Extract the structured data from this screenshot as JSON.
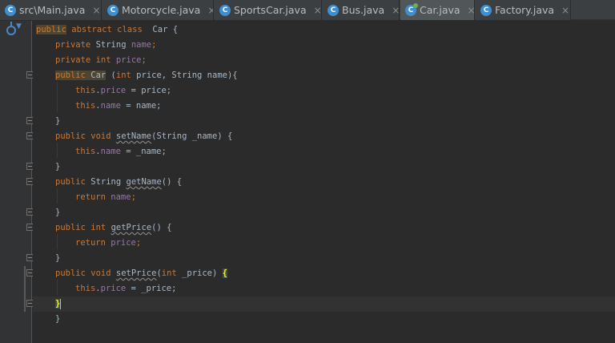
{
  "tabs": [
    {
      "label": "src\\Main.java",
      "icon": "class-icon",
      "active": false
    },
    {
      "label": "Motorcycle.java",
      "icon": "class-icon",
      "active": false
    },
    {
      "label": "SportsCar.java",
      "icon": "class-icon",
      "active": false
    },
    {
      "label": "Bus.java",
      "icon": "class-icon",
      "active": false
    },
    {
      "label": "Car.java",
      "icon": "abstract-class-icon",
      "active": true
    },
    {
      "label": "Factory.java",
      "icon": "class-icon",
      "active": false
    }
  ],
  "tab_icon_letter": "C",
  "tab_close_glyph": "×",
  "gutter_icon": "implemented-by-icon",
  "code": {
    "l1": {
      "t1": "public",
      "t2": " abstract",
      "t3": " class",
      "t4": "  Car {"
    },
    "l2": {
      "t1": "private",
      "t2": " String ",
      "t3": "name",
      "t4": ";"
    },
    "l3": {
      "t1": "private",
      "t2": " int ",
      "t3": "price",
      "t4": ";"
    },
    "l4": {
      "t1": "public",
      "t2": " Car",
      "t3": " (",
      "t4": "int",
      "t5": " price, String name){"
    },
    "l5": {
      "t1": "this",
      "t2": ".",
      "t3": "price",
      "t4": " = price;"
    },
    "l6": {
      "t1": "this",
      "t2": ".",
      "t3": "name",
      "t4": " = name;"
    },
    "l7": {
      "t1": "}"
    },
    "l8": {
      "t1": "public",
      "t2": " void",
      "t3": " ",
      "t4": "setName",
      "t5": "(String _name) {"
    },
    "l9": {
      "t1": "this",
      "t2": ".",
      "t3": "name",
      "t4": " = _name;"
    },
    "l10": {
      "t1": "}"
    },
    "l11": {
      "t1": "public",
      "t2": " String ",
      "t3": "getName",
      "t4": "() {"
    },
    "l12": {
      "t1": "return",
      "t2": " ",
      "t3": "name",
      "t4": ";"
    },
    "l13": {
      "t1": "}"
    },
    "l14": {
      "t1": "public",
      "t2": " int",
      "t3": " ",
      "t4": "getPrice",
      "t5": "() {"
    },
    "l15": {
      "t1": "return",
      "t2": " ",
      "t3": "price",
      "t4": ";"
    },
    "l16": {
      "t1": "}"
    },
    "l17": {
      "t1": "public",
      "t2": " void",
      "t3": " ",
      "t4": "setPrice",
      "t5": "(",
      "t6": "int",
      "t7": " _price) ",
      "t8": "{"
    },
    "l18": {
      "t1": "this",
      "t2": ".",
      "t3": "price",
      "t4": " = _price;"
    },
    "l19": {
      "t1": "}"
    },
    "l20": {
      "t1": "}"
    }
  }
}
